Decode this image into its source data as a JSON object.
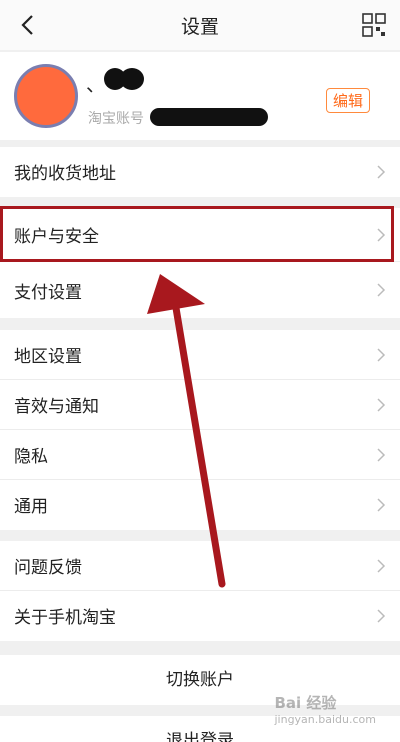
{
  "header": {
    "title": "设置"
  },
  "profile": {
    "username_prefix": "、",
    "account_label": "淘宝账号",
    "edit_label": "编辑"
  },
  "section1": [
    {
      "label": "我的收货地址"
    }
  ],
  "section2": [
    {
      "label": "账户与安全"
    },
    {
      "label": "支付设置"
    }
  ],
  "section3": [
    {
      "label": "地区设置"
    },
    {
      "label": "音效与通知"
    },
    {
      "label": "隐私"
    },
    {
      "label": "通用"
    }
  ],
  "section4": [
    {
      "label": "问题反馈"
    },
    {
      "label": "关于手机淘宝"
    }
  ],
  "actions": {
    "switch_account": "切换账户",
    "logout": "退出登录"
  },
  "watermark": {
    "main": "Bai 经验",
    "sub": "jingyan.baidu.com"
  },
  "colors": {
    "highlight_box": "#a8181e",
    "arrow": "#a8181e",
    "edit_accent": "#ff6a1a",
    "avatar": "#ff6a3d"
  },
  "icons": {
    "back": "back-chevron-icon",
    "grid": "grid-menu-icon",
    "row_chevron": "chevron-right-icon"
  }
}
